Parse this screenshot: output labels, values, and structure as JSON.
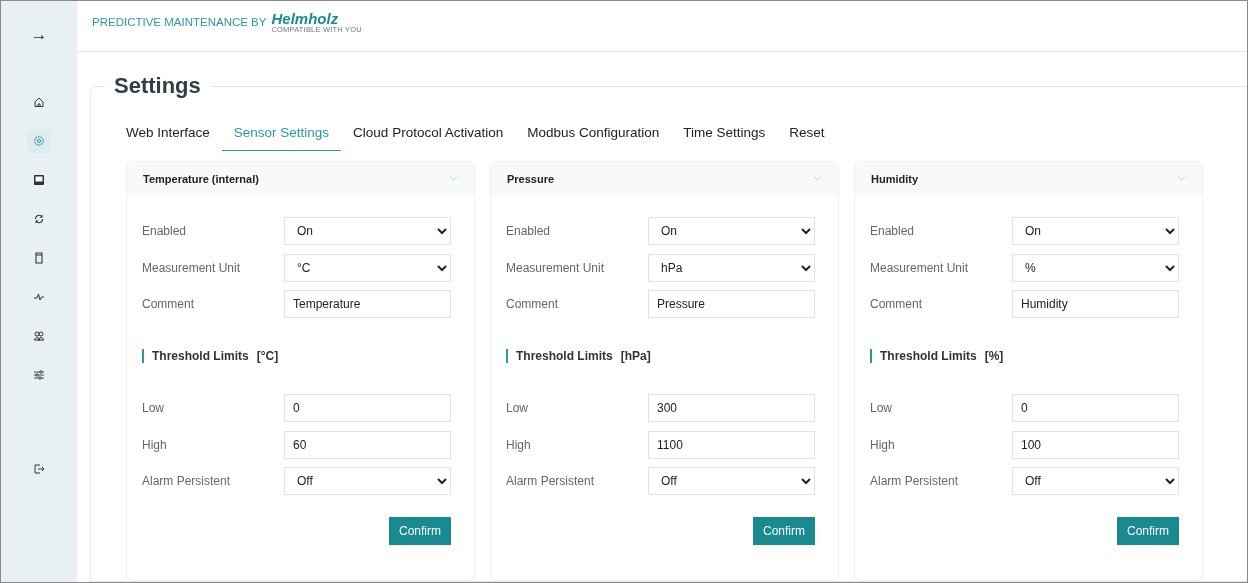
{
  "sidebar": {
    "toggle": "→",
    "items": [
      {
        "selected": false
      },
      {
        "selected": true
      },
      {
        "selected": false
      },
      {
        "selected": false
      },
      {
        "selected": false
      },
      {
        "selected": false
      },
      {
        "selected": false
      },
      {
        "selected": false
      }
    ]
  },
  "header": {
    "product": "PREDICTIVE MAINTENANCE BY",
    "brand": "Helmholz",
    "tagline": "COMPATIBLE WITH YOU"
  },
  "page_title": "Settings",
  "tabs": [
    {
      "label": "Web Interface",
      "selected": false
    },
    {
      "label": "Sensor Settings",
      "selected": true
    },
    {
      "label": "Cloud Protocol Activation",
      "selected": false
    },
    {
      "label": "Modbus Configuration",
      "selected": false
    },
    {
      "label": "Time Settings",
      "selected": false
    },
    {
      "label": "Reset",
      "selected": false
    }
  ],
  "cards": [
    {
      "title": "Temperature (internal)",
      "fields": [
        {
          "label": "Enabled",
          "kind": "select",
          "value": "On"
        },
        {
          "label": "Measurement Unit",
          "kind": "select",
          "value": "°C"
        },
        {
          "label": "Comment",
          "kind": "input",
          "value": "Temperature"
        }
      ],
      "threshold": {
        "label": "Threshold Limits",
        "unit": "[°C]"
      },
      "limits": [
        {
          "label": "Low",
          "kind": "input",
          "value": "0"
        },
        {
          "label": "High",
          "kind": "input",
          "value": "60"
        },
        {
          "label": "Alarm Persistent",
          "kind": "select",
          "value": "Off"
        }
      ],
      "button": "Confirm"
    },
    {
      "title": "Pressure",
      "fields": [
        {
          "label": "Enabled",
          "kind": "select",
          "value": "On"
        },
        {
          "label": "Measurement Unit",
          "kind": "select",
          "value": "hPa"
        },
        {
          "label": "Comment",
          "kind": "input",
          "value": "Pressure"
        }
      ],
      "threshold": {
        "label": "Threshold Limits",
        "unit": "[hPa]"
      },
      "limits": [
        {
          "label": "Low",
          "kind": "input",
          "value": "300"
        },
        {
          "label": "High",
          "kind": "input",
          "value": "1100"
        },
        {
          "label": "Alarm Persistent",
          "kind": "select",
          "value": "Off"
        }
      ],
      "button": "Confirm"
    },
    {
      "title": "Humidity",
      "fields": [
        {
          "label": "Enabled",
          "kind": "select",
          "value": "On"
        },
        {
          "label": "Measurement Unit",
          "kind": "select",
          "value": "%"
        },
        {
          "label": "Comment",
          "kind": "input",
          "value": "Humidity"
        }
      ],
      "threshold": {
        "label": "Threshold Limits",
        "unit": "[%]"
      },
      "limits": [
        {
          "label": "Low",
          "kind": "input",
          "value": "0"
        },
        {
          "label": "High",
          "kind": "input",
          "value": "100"
        },
        {
          "label": "Alarm Persistent",
          "kind": "select",
          "value": "Off"
        }
      ],
      "button": "Confirm"
    }
  ]
}
